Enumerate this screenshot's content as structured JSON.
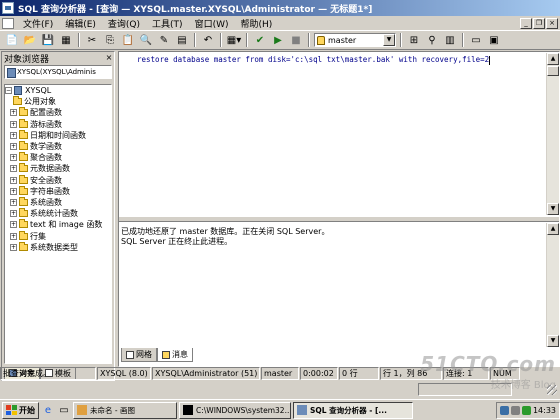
{
  "window": {
    "title": "SQL 查询分析器 - [查询 — XYSQL.master.XYSQL\\Administrator — 无标题1*]"
  },
  "menu": [
    "文件(F)",
    "编辑(E)",
    "查询(Q)",
    "工具(T)",
    "窗口(W)",
    "帮助(H)"
  ],
  "toolbar": {
    "database_select": "master"
  },
  "object_browser": {
    "title": "对象浏览器",
    "server_combo": "XYSQL(XYSQL\\Adminis",
    "root": "XYSQL",
    "group": "公用对象",
    "items": [
      "配置函数",
      "游标函数",
      "日期和时间函数",
      "数学函数",
      "聚合函数",
      "元数据函数",
      "安全函数",
      "字符串函数",
      "系统函数",
      "系统统计函数",
      "text 和 image 函数",
      "行集",
      "系统数据类型"
    ],
    "tabs": [
      "对象",
      "模板"
    ]
  },
  "editor": {
    "query": "restore database master from disk='c:\\sql txt\\master.bak' with recovery,file=2"
  },
  "results": {
    "lines": [
      "已成功地还原了 master 数据库。正在关闭 SQL Server。",
      "SQL Server 正在终止此进程。"
    ],
    "tabs": [
      "网格",
      "消息"
    ]
  },
  "statusbar": {
    "message": "批查询完成。",
    "server": "XYSQL (8.0)",
    "user": "XYSQL\\Administrator (51)",
    "database": "master",
    "time": "0:00:02",
    "rows": "0 行",
    "position": "行 1，列 86",
    "connections": "连接: 1",
    "mode": "NUM"
  },
  "taskbar": {
    "start_label": "开始",
    "tasks": [
      "未命名 - 画图",
      "C:\\WINDOWS\\system32...",
      "SQL 查询分析器 - [..."
    ],
    "clock": "14:33"
  },
  "watermark": {
    "main": "51CTO.com",
    "sub": "技术博客 Blog"
  },
  "colors": {
    "title_active": "#0a246a",
    "title_gradient_end": "#a6caf0",
    "face": "#d4d0c8",
    "folder": "#ffd75e"
  }
}
